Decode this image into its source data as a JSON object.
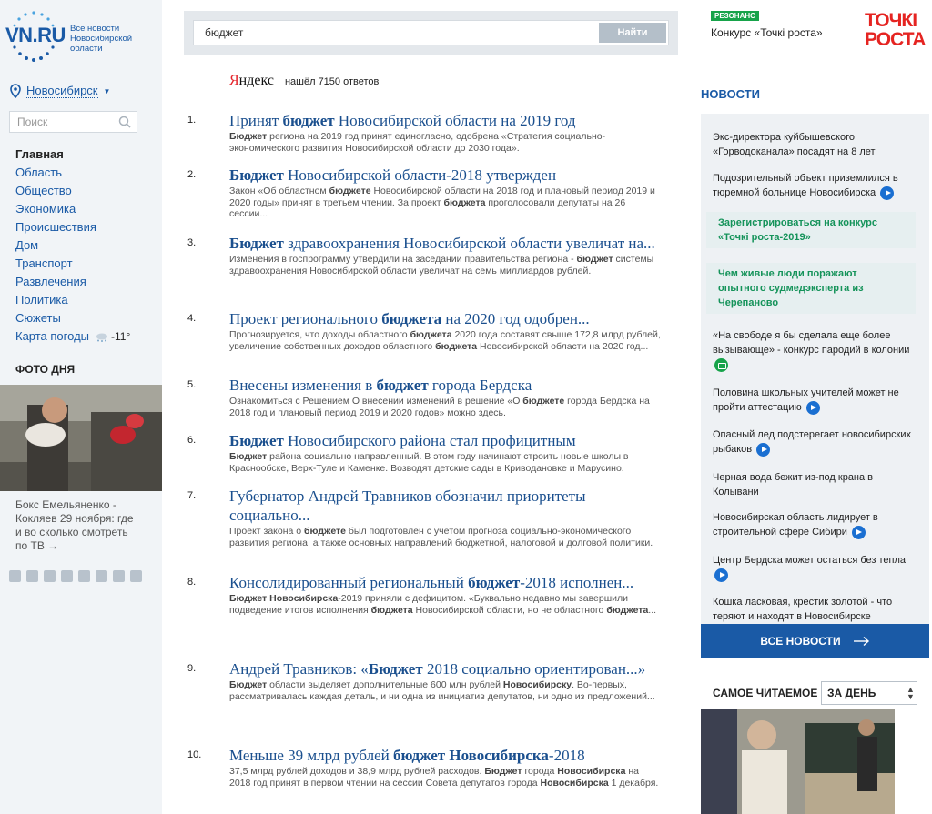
{
  "logo": {
    "text": "VN.RU",
    "subtitle": "Все новости Новосибирской области"
  },
  "city": {
    "label": "Новосибирск"
  },
  "side_search": {
    "placeholder": "Поиск"
  },
  "nav": {
    "items": [
      "Главная",
      "Область",
      "Общество",
      "Экономика",
      "Происшествия",
      "Дом",
      "Транспорт",
      "Развлечения",
      "Политика",
      "Сюжеты"
    ],
    "weather_label": "Карта погоды",
    "temperature": "-11°"
  },
  "photo_day": {
    "title": "ФОТО ДНЯ",
    "caption": "Бокс Емельяненко - Кокляев 29 ноября: где и во сколько смотреть по ТВ →"
  },
  "search": {
    "value": "бюджет",
    "button": "Найти"
  },
  "yandex": {
    "brand_y": "Я",
    "brand_rest": "ндекс",
    "found": "нашёл 7150 ответов"
  },
  "results": [
    {
      "num": "1.",
      "title": [
        {
          "t": "Принят ",
          "b": false
        },
        {
          "t": "бюджет",
          "b": true
        },
        {
          "t": " Новосибирской области на 2019 год",
          "b": false
        }
      ],
      "snippet": [
        {
          "t": "Бюджет",
          "b": true
        },
        {
          "t": " региона на 2019 год принят единогласно, одобрена «Стратегия социально-экономического развития Новосибирской области до 2030 года».",
          "b": false
        }
      ]
    },
    {
      "num": "2.",
      "title": [
        {
          "t": "Бюджет",
          "b": true
        },
        {
          "t": " Новосибирской области-2018 утвержден",
          "b": false
        }
      ],
      "snippet": [
        {
          "t": "Закон «Об областном ",
          "b": false
        },
        {
          "t": "бюджете",
          "b": true
        },
        {
          "t": " Новосибирской области на 2018 год и плановый период 2019 и 2020 годы» принят в третьем чтении. За проект ",
          "b": false
        },
        {
          "t": "бюджета",
          "b": true
        },
        {
          "t": " проголосовали депутаты на 26 сессии...",
          "b": false
        }
      ]
    },
    {
      "num": "3.",
      "title": [
        {
          "t": "Бюджет",
          "b": true
        },
        {
          "t": " здравоохранения Новосибирской области увеличат на...",
          "b": false
        }
      ],
      "snippet": [
        {
          "t": "Изменения в госпрограмму утвердили на заседании правительства региона - ",
          "b": false
        },
        {
          "t": "бюджет",
          "b": true
        },
        {
          "t": " системы здравоохранения Новосибирской области увеличат на семь миллиардов рублей.",
          "b": false
        }
      ]
    },
    {
      "num": "4.",
      "title": [
        {
          "t": "Проект регионального ",
          "b": false
        },
        {
          "t": "бюджета",
          "b": true
        },
        {
          "t": " на 2020 год одобрен...",
          "b": false
        }
      ],
      "snippet": [
        {
          "t": "Прогнозируется, что доходы областного ",
          "b": false
        },
        {
          "t": "бюджета",
          "b": true
        },
        {
          "t": " 2020 года составят свыше 172,8 млрд рублей, увеличение собственных доходов областного ",
          "b": false
        },
        {
          "t": "бюджета",
          "b": true
        },
        {
          "t": " Новосибирской области на 2020 год...",
          "b": false
        }
      ]
    },
    {
      "num": "5.",
      "title": [
        {
          "t": "Внесены изменения в ",
          "b": false
        },
        {
          "t": "бюджет",
          "b": true
        },
        {
          "t": " города Бердска",
          "b": false
        }
      ],
      "snippet": [
        {
          "t": "Ознакомиться с Решением О внесении изменений в решение «О ",
          "b": false
        },
        {
          "t": "бюджете",
          "b": true
        },
        {
          "t": " города Бердска на 2018 год и плановый период 2019 и 2020 годов» можно здесь.",
          "b": false
        }
      ]
    },
    {
      "num": "6.",
      "title": [
        {
          "t": "Бюджет",
          "b": true
        },
        {
          "t": " Новосибирского района стал профицитным",
          "b": false
        }
      ],
      "snippet": [
        {
          "t": "Бюджет",
          "b": true
        },
        {
          "t": " района социально направленный. В этом году начинают строить новые школы в Краснообске, Верх-Туле и Каменке. Возводят детские сады в Криводановке и Марусино.",
          "b": false
        }
      ]
    },
    {
      "num": "7.",
      "title": [
        {
          "t": "Губернатор Андрей Травников обозначил приоритеты социально...",
          "b": false
        }
      ],
      "snippet": [
        {
          "t": "Проект закона о ",
          "b": false
        },
        {
          "t": "бюджете",
          "b": true
        },
        {
          "t": " был подготовлен с учётом прогноза социально-экономического развития региона, а также основных направлений бюджетной, налоговой и долговой политики.",
          "b": false
        }
      ]
    },
    {
      "num": "8.",
      "title": [
        {
          "t": "Консолидированный региональный ",
          "b": false
        },
        {
          "t": "бюджет",
          "b": true
        },
        {
          "t": "-2018 исполнен...",
          "b": false
        }
      ],
      "snippet": [
        {
          "t": "Бюджет Новосибирска",
          "b": true
        },
        {
          "t": "-2019 приняли с дефицитом. «Буквально недавно мы завершили подведение итогов исполнения ",
          "b": false
        },
        {
          "t": "бюджета",
          "b": true
        },
        {
          "t": " Новосибирской области, но не областного ",
          "b": false
        },
        {
          "t": "бюджета",
          "b": true
        },
        {
          "t": "...",
          "b": false
        }
      ]
    },
    {
      "num": "9.",
      "title": [
        {
          "t": "Андрей Травников: «",
          "b": false
        },
        {
          "t": "Бюджет",
          "b": true
        },
        {
          "t": " 2018 социально ориентирован...»",
          "b": false
        }
      ],
      "snippet": [
        {
          "t": "Бюджет",
          "b": true
        },
        {
          "t": " области выделяет дополнительные 600 млн рублей ",
          "b": false
        },
        {
          "t": "Новосибирску",
          "b": true
        },
        {
          "t": ". Во-первых, рассматривалась каждая деталь, и ни одна из инициатив депутатов, ни одно из предложений...",
          "b": false
        }
      ]
    },
    {
      "num": "10.",
      "title": [
        {
          "t": "Меньше 39 млрд рублей ",
          "b": false
        },
        {
          "t": "бюджет Новосибирска",
          "b": true
        },
        {
          "t": "-2018",
          "b": false
        }
      ],
      "snippet": [
        {
          "t": "37,5 млрд рублей доходов и 38,9 млрд рублей расходов. ",
          "b": false
        },
        {
          "t": "Бюджет",
          "b": true
        },
        {
          "t": " города ",
          "b": false
        },
        {
          "t": "Новосибирска",
          "b": true
        },
        {
          "t": " на 2018 год принят в первом чтении на сессии Совета депутатов города ",
          "b": false
        },
        {
          "t": "Новосибирска",
          "b": true
        },
        {
          "t": " 1 декабря.",
          "b": false
        }
      ]
    }
  ],
  "ad": {
    "badge": "РЕЗОНАНС",
    "text": "Конкурс «Точкі роста»",
    "logo_line1": "ТОЧКІ",
    "logo_line2": "РОСТА"
  },
  "news": {
    "title": "НОВОСТИ",
    "items": [
      {
        "text": "Экс-директора куйбышевского «Горводоканала» посадят на 8 лет",
        "icon": "",
        "promo": false
      },
      {
        "text": "Подозрительный объект приземлился в тюремной больнице Новосибирска",
        "icon": "play",
        "promo": false
      },
      {
        "text": "Зарегистрироваться на конкурс «Точкі роста-2019»",
        "icon": "",
        "promo": true
      },
      {
        "text": "Чем живые люди поражают опытного судмедэксперта из Черепаново",
        "icon": "",
        "promo": true
      },
      {
        "text": "«На свободе я бы сделала еще более вызывающе» - конкурс пародий в колонии",
        "icon": "camera",
        "promo": false
      },
      {
        "text": "Половина школьных учителей может не пройти аттестацию",
        "icon": "play",
        "promo": false
      },
      {
        "text": "Опасный лед подстерегает новосибирских рыбаков",
        "icon": "play",
        "promo": false
      },
      {
        "text": "Черная вода бежит из-под крана в Колывани",
        "icon": "",
        "promo": false
      },
      {
        "text": "Новосибирская область лидирует в строительной сфере Сибири",
        "icon": "play",
        "promo": false
      },
      {
        "text": "Центр Бердска может остаться без тепла",
        "icon": "play",
        "promo": false
      },
      {
        "text": "Кошка ласковая, крестик золотой - что теряют и находят в Новосибирске",
        "icon": "",
        "promo": false
      }
    ],
    "all_button": "ВСЕ НОВОСТИ"
  },
  "most_read": {
    "title": "САМОЕ ЧИТАЕМОЕ",
    "period": "ЗА ДЕНЬ"
  },
  "colors": {
    "brand_blue": "#1a5aa6",
    "link_blue": "#1a4f8e",
    "promo_green": "#15935a",
    "yandex_red": "#e4242b"
  }
}
